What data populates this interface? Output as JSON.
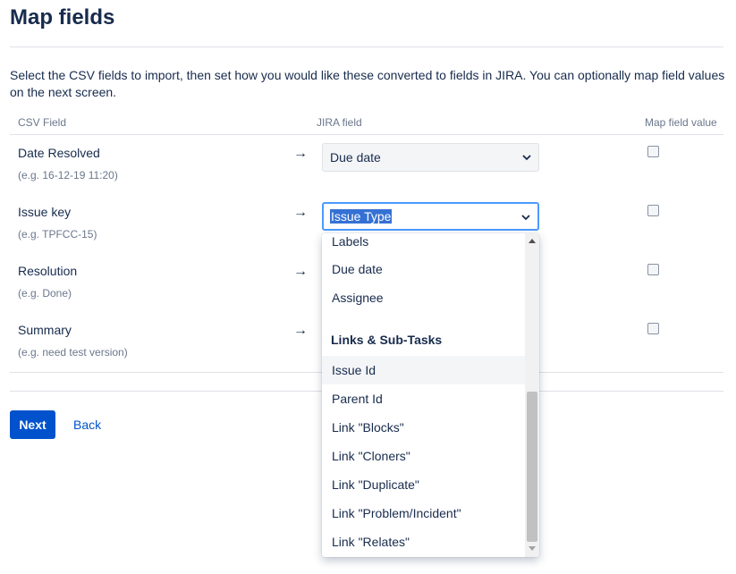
{
  "page": {
    "title": "Map fields",
    "description": "Select the CSV fields to import, then set how you would like these converted to fields in JIRA. You can optionally map field values on the next screen."
  },
  "table": {
    "headers": {
      "csv_field": "CSV Field",
      "jira_field": "JIRA field",
      "map_value": "Map field value"
    },
    "rows": [
      {
        "name": "Date Resolved",
        "example": "(e.g. 16-12-19 11:20)",
        "arrow": "→",
        "jira_field": "Due date",
        "map_checked": false
      },
      {
        "name": "Issue key",
        "example": "(e.g. TPFCC-15)",
        "arrow": "→",
        "jira_field": "Issue Type",
        "map_checked": false
      },
      {
        "name": "Resolution",
        "example": "(e.g. Done)",
        "arrow": "→",
        "jira_field": "",
        "map_checked": false
      },
      {
        "name": "Summary",
        "example": "(e.g. need test version)",
        "arrow": "→",
        "jira_field": "",
        "map_checked": false
      }
    ]
  },
  "dropdown": {
    "items_before": [
      "Labels",
      "Due date",
      "Assignee"
    ],
    "group_label": "Links & Sub-Tasks",
    "items_after": [
      "Issue Id",
      "Parent Id",
      "Link \"Blocks\"",
      "Link \"Cloners\"",
      "Link \"Duplicate\"",
      "Link \"Problem/Incident\"",
      "Link \"Relates\""
    ],
    "hovered_item": "Issue Id"
  },
  "actions": {
    "next_label": "Next",
    "back_label": "Back"
  },
  "colors": {
    "primary": "#0052cc",
    "text": "#172b4d",
    "subtle": "#6b778c",
    "focus": "#4c9aff",
    "selection": "#3571d4"
  },
  "icons": {
    "select_caret": "chevron-down-icon",
    "row_arrow": "arrow-right-icon"
  }
}
